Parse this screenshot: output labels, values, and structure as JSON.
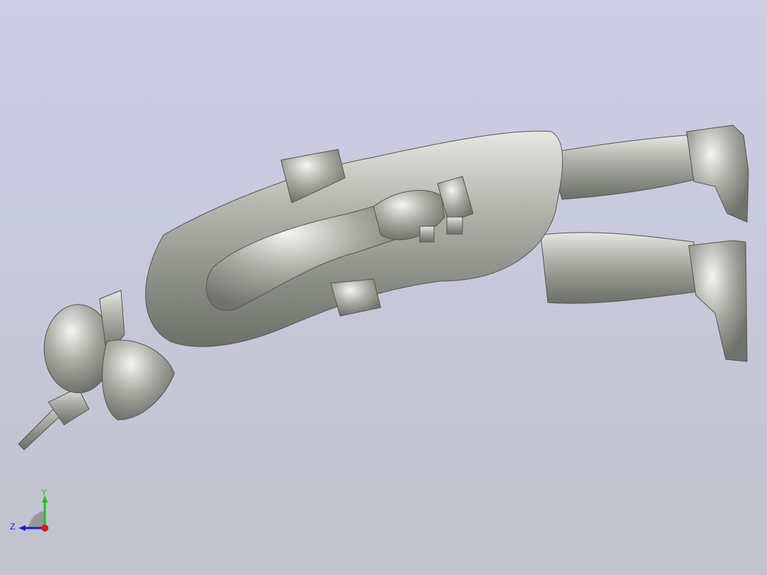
{
  "viewport": {
    "model_description_icon": "soldier-figure-3d-model",
    "background_top": "#cdcde6",
    "background_bottom": "#c0c2cc",
    "model_color": "#a3a59f"
  },
  "triad": {
    "y_label": "Y",
    "z_label": "Z",
    "y_color": "#1fc21f",
    "z_color": "#1a1ad8",
    "x_color": "#e01818"
  }
}
